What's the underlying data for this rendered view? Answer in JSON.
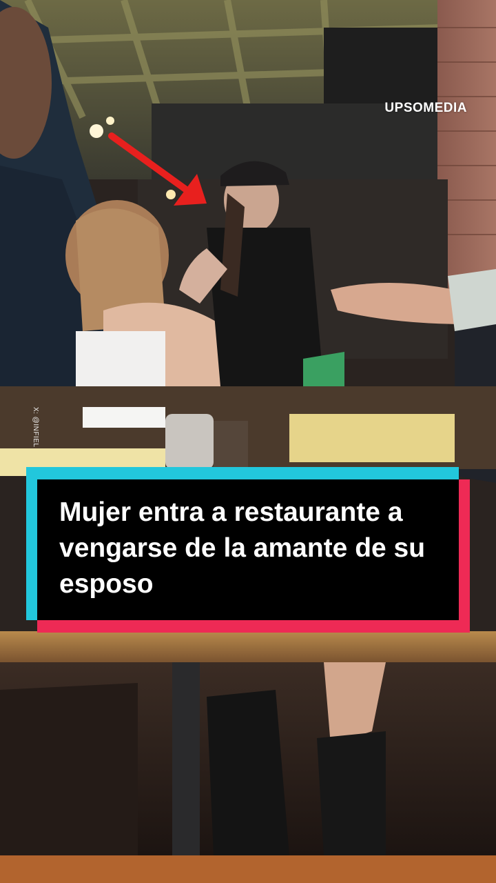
{
  "watermark": "UPSOMEDIA",
  "source_credit": "X: @INFIEL",
  "caption": "Mujer entra a restaurante a vengarse de la amante de su esposo",
  "colors": {
    "caption_background": "#000000",
    "caption_text": "#ffffff",
    "accent_cyan": "#22c7dc",
    "accent_red": "#ee2a55",
    "arrow": "#e8201e"
  }
}
